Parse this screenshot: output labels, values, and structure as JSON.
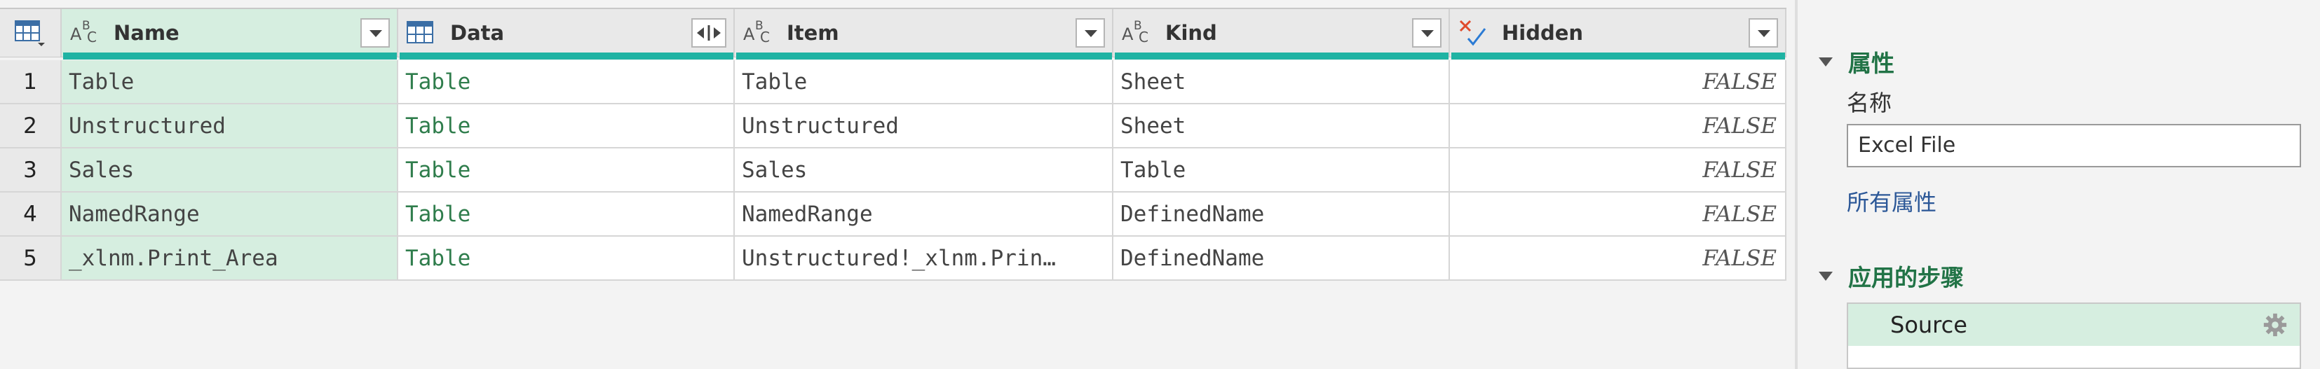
{
  "table": {
    "columns": [
      {
        "name": "Name",
        "type_icon": "abc-text-type-icon",
        "selected": true
      },
      {
        "name": "Data",
        "type_icon": "table-type-icon",
        "selected": false
      },
      {
        "name": "Item",
        "type_icon": "abc-text-type-icon",
        "selected": false
      },
      {
        "name": "Kind",
        "type_icon": "abc-text-type-icon",
        "selected": false
      },
      {
        "name": "Hidden",
        "type_icon": "logical-type-icon",
        "selected": false
      }
    ],
    "rows": [
      {
        "n": "1",
        "name": "Table",
        "data": "Table",
        "item": "Table",
        "kind": "Sheet",
        "hidden": "FALSE"
      },
      {
        "n": "2",
        "name": "Unstructured",
        "data": "Table",
        "item": "Unstructured",
        "kind": "Sheet",
        "hidden": "FALSE"
      },
      {
        "n": "3",
        "name": "Sales",
        "data": "Table",
        "item": "Sales",
        "kind": "Table",
        "hidden": "FALSE"
      },
      {
        "n": "4",
        "name": "NamedRange",
        "data": "Table",
        "item": "NamedRange",
        "kind": "DefinedName",
        "hidden": "FALSE"
      },
      {
        "n": "5",
        "name": "_xlnm.Print_Area",
        "data": "Table",
        "item": "Unstructured!_xlnm.Prin…",
        "kind": "DefinedName",
        "hidden": "FALSE"
      }
    ],
    "quality_color": "#1fb3a3",
    "selected_color": "#d6eee0"
  },
  "properties": {
    "section_title": "属性",
    "name_label": "名称",
    "name_value": "Excel File",
    "all_properties_link": "所有属性"
  },
  "applied_steps": {
    "section_title": "应用的步骤",
    "steps": [
      {
        "label": "Source",
        "icon": "gear-icon"
      }
    ]
  },
  "colors": {
    "accent_green": "#217346",
    "link_blue": "#2b5797"
  }
}
